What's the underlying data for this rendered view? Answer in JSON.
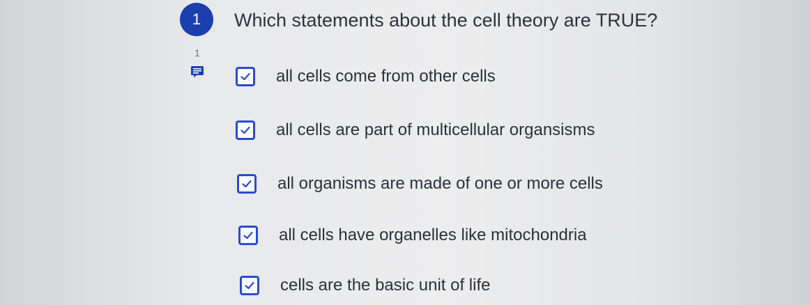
{
  "question": {
    "number": "1",
    "text": "Which statements about the cell theory are TRUE?",
    "comment_count": "1"
  },
  "options": [
    {
      "label": "all cells come from other cells",
      "checked": true
    },
    {
      "label": "all cells are part of multicellular organsisms",
      "checked": true
    },
    {
      "label": "all organisms are made of one or more cells",
      "checked": true
    },
    {
      "label": "all cells have organelles like mitochondria",
      "checked": true
    },
    {
      "label": "cells are the basic unit of life",
      "checked": true
    }
  ],
  "colors": {
    "accent": "#1b3fae",
    "checkbox_border": "#2a4bd2",
    "text": "#2c3038"
  },
  "icons": {
    "comment": "comment-icon",
    "check": "checkmark-icon"
  }
}
